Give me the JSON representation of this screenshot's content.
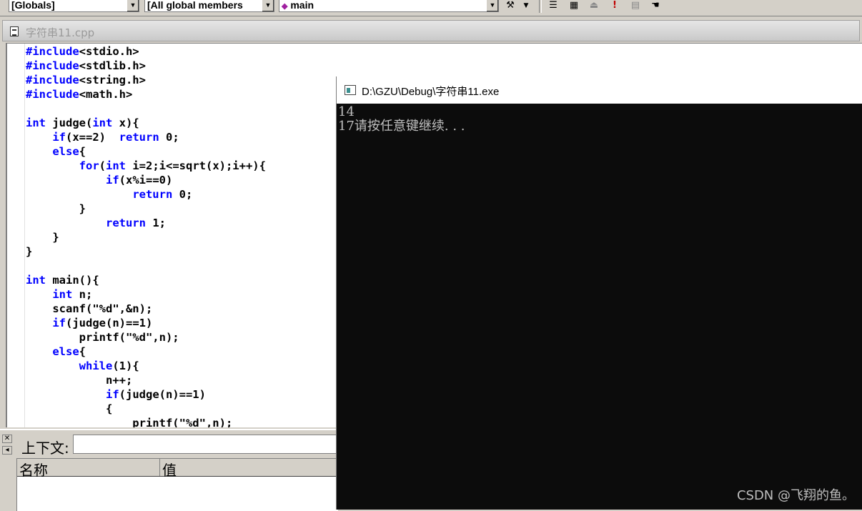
{
  "toolbar": {
    "scope_combo": "[Globals]",
    "members_combo": "[All global members",
    "function_combo": "main"
  },
  "editor": {
    "tab_title": "字符串11.cpp",
    "code_lines": [
      [
        {
          "t": "#include",
          "k": true
        },
        {
          "t": "<stdio.h>"
        }
      ],
      [
        {
          "t": "#include",
          "k": true
        },
        {
          "t": "<stdlib.h>"
        }
      ],
      [
        {
          "t": "#include",
          "k": true
        },
        {
          "t": "<string.h>"
        }
      ],
      [
        {
          "t": "#include",
          "k": true
        },
        {
          "t": "<math.h>"
        }
      ],
      [],
      [
        {
          "t": "int",
          "k": true
        },
        {
          "t": " judge("
        },
        {
          "t": "int",
          "k": true
        },
        {
          "t": " x){"
        }
      ],
      [
        {
          "t": "    "
        },
        {
          "t": "if",
          "k": true
        },
        {
          "t": "(x==2)  "
        },
        {
          "t": "return",
          "k": true
        },
        {
          "t": " 0;"
        }
      ],
      [
        {
          "t": "    "
        },
        {
          "t": "else",
          "k": true
        },
        {
          "t": "{"
        }
      ],
      [
        {
          "t": "        "
        },
        {
          "t": "for",
          "k": true
        },
        {
          "t": "("
        },
        {
          "t": "int",
          "k": true
        },
        {
          "t": " i=2;i<=sqrt(x);i++){"
        }
      ],
      [
        {
          "t": "            "
        },
        {
          "t": "if",
          "k": true
        },
        {
          "t": "(x%i==0)"
        }
      ],
      [
        {
          "t": "                "
        },
        {
          "t": "return",
          "k": true
        },
        {
          "t": " 0;"
        }
      ],
      [
        {
          "t": "        }"
        }
      ],
      [
        {
          "t": "            "
        },
        {
          "t": "return",
          "k": true
        },
        {
          "t": " 1;"
        }
      ],
      [
        {
          "t": "    }"
        }
      ],
      [
        {
          "t": "}"
        }
      ],
      [],
      [
        {
          "t": "int",
          "k": true
        },
        {
          "t": " main(){"
        }
      ],
      [
        {
          "t": "    "
        },
        {
          "t": "int",
          "k": true
        },
        {
          "t": " n;"
        }
      ],
      [
        {
          "t": "    scanf(\"%d\",&n);"
        }
      ],
      [
        {
          "t": "    "
        },
        {
          "t": "if",
          "k": true
        },
        {
          "t": "(judge(n)==1)"
        }
      ],
      [
        {
          "t": "        printf(\"%d\",n);"
        }
      ],
      [
        {
          "t": "    "
        },
        {
          "t": "else",
          "k": true
        },
        {
          "t": "{"
        }
      ],
      [
        {
          "t": "        "
        },
        {
          "t": "while",
          "k": true
        },
        {
          "t": "(1){"
        }
      ],
      [
        {
          "t": "            n++;"
        }
      ],
      [
        {
          "t": "            "
        },
        {
          "t": "if",
          "k": true
        },
        {
          "t": "(judge(n)==1)"
        }
      ],
      [
        {
          "t": "            {"
        }
      ],
      [
        {
          "t": "                printf(\"%d\",n);"
        }
      ]
    ]
  },
  "debug_panel": {
    "context_label": "上下文:",
    "col_name": "名称",
    "col_value": "值"
  },
  "console": {
    "title": "D:\\GZU\\Debug\\字符串11.exe",
    "lines": [
      "14",
      "17请按任意键继续. . ."
    ]
  },
  "watermark": "CSDN @飞翔的鱼。"
}
